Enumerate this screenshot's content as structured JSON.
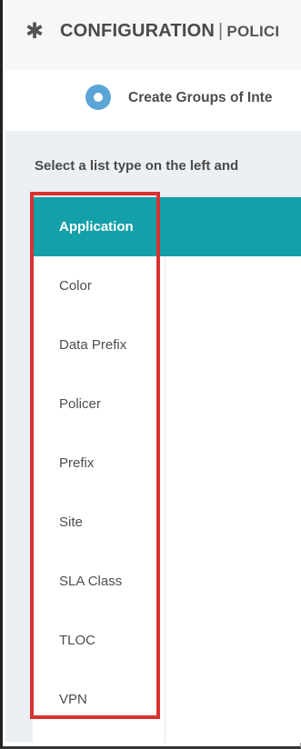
{
  "header": {
    "title": "CONFIGURATION",
    "separator": "|",
    "breadcrumb": "POLICI",
    "icon": "gear-icon"
  },
  "step": {
    "icon": "step-circle-icon",
    "label": "Create Groups of Inte"
  },
  "panel": {
    "instruction": "Select a list type on the left and"
  },
  "list_types": [
    {
      "label": "Application",
      "selected": true
    },
    {
      "label": "Color",
      "selected": false
    },
    {
      "label": "Data Prefix",
      "selected": false
    },
    {
      "label": "Policer",
      "selected": false
    },
    {
      "label": "Prefix",
      "selected": false
    },
    {
      "label": "Site",
      "selected": false
    },
    {
      "label": "SLA Class",
      "selected": false
    },
    {
      "label": "TLOC",
      "selected": false
    },
    {
      "label": "VPN",
      "selected": false
    }
  ],
  "colors": {
    "accent": "#14a0a8",
    "highlight": "#d8322f",
    "step_icon": "#5aa5d6"
  }
}
